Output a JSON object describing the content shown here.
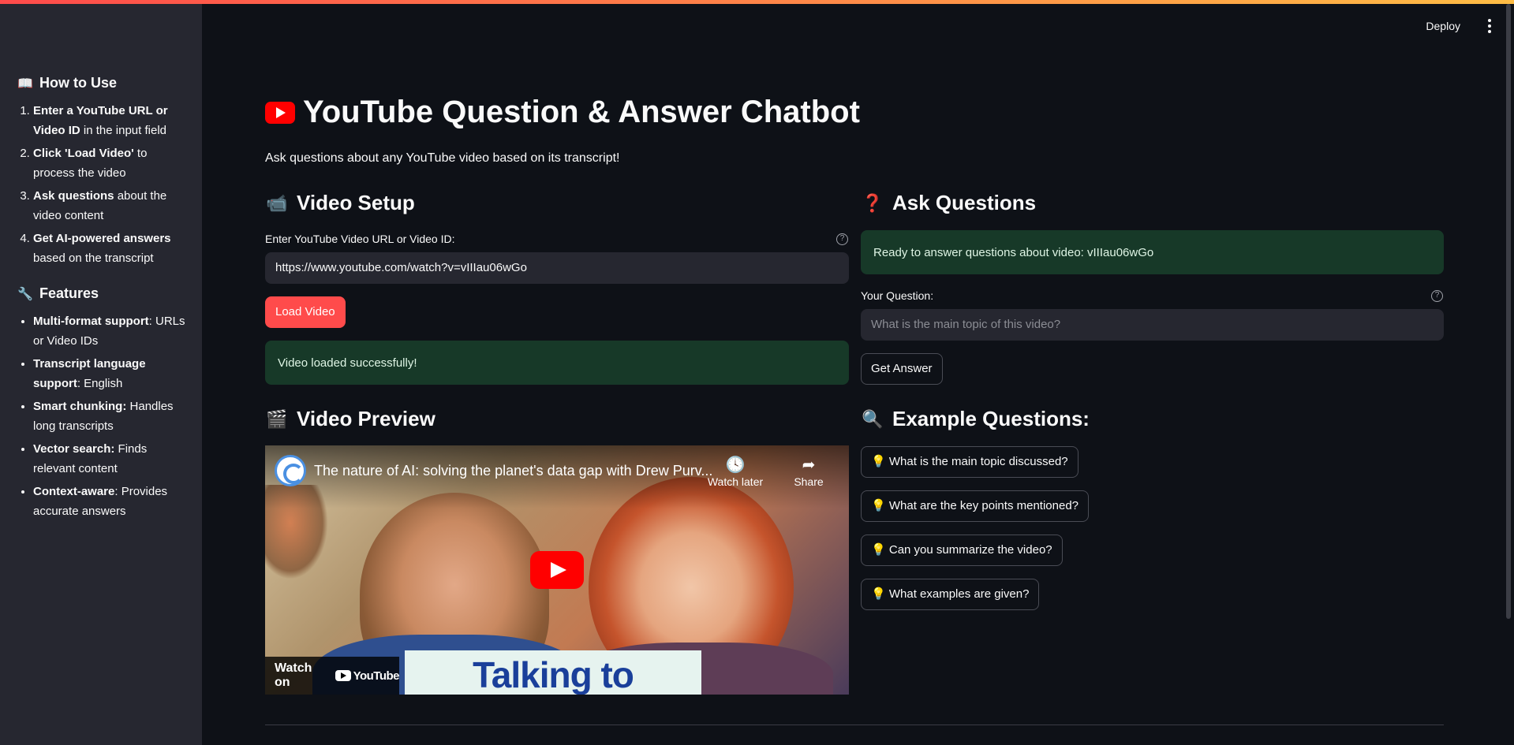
{
  "header": {
    "deploy_label": "Deploy"
  },
  "sidebar": {
    "how_to_use": {
      "title": "How to Use",
      "icon": "book-icon",
      "items": [
        {
          "bold": "Enter a YouTube URL or Video ID",
          "rest": " in the input field"
        },
        {
          "bold": "Click 'Load Video'",
          "rest": " to process the video"
        },
        {
          "bold": "Ask questions",
          "rest": " about the video content"
        },
        {
          "bold": "Get AI-powered answers",
          "rest": " based on the transcript"
        }
      ]
    },
    "features": {
      "title": "Features",
      "icon": "wrench-icon",
      "items": [
        {
          "bold": "Multi-format support",
          "rest": ": URLs or Video IDs"
        },
        {
          "bold": "Transcript language support",
          "rest": ": English"
        },
        {
          "bold": "Smart chunking:",
          "rest": " Handles long transcripts"
        },
        {
          "bold": "Vector search:",
          "rest": " Finds relevant content"
        },
        {
          "bold": "Context-aware",
          "rest": ": Provides accurate answers"
        }
      ]
    }
  },
  "main": {
    "title": "YouTube Question & Answer Chatbot",
    "subtitle": "Ask questions about any YouTube video based on its transcript!",
    "video_setup": {
      "heading": "Video Setup",
      "icon": "video-camera-icon",
      "input_label": "Enter YouTube Video URL or Video ID:",
      "input_value": "https://www.youtube.com/watch?v=vIIIau06wGo",
      "load_button": "Load Video",
      "success_message": "Video loaded successfully!"
    },
    "video_preview": {
      "heading": "Video Preview",
      "icon": "clapperboard-icon",
      "video_title": "The nature of AI: solving the planet's data gap with Drew Purv...",
      "watch_later": "Watch later",
      "share": "Share",
      "watch_on": "Watch on",
      "youtube_wordmark": "YouTube",
      "thumbnail_card_text": "Talking to animals?"
    },
    "ask_questions": {
      "heading": "Ask Questions",
      "icon": "question-mark-icon",
      "ready_message": "Ready to answer questions about video: vIIIau06wGo",
      "question_label": "Your Question:",
      "question_placeholder": "What is the main topic of this video?",
      "get_answer_button": "Get Answer"
    },
    "example_questions": {
      "heading": "Example Questions:",
      "icon": "magnifier-icon",
      "items": [
        "What is the main topic discussed?",
        "What are the key points mentioned?",
        "Can you summarize the video?",
        "What examples are given?"
      ]
    }
  },
  "colors": {
    "background": "#0e1117",
    "sidebar": "#262730",
    "accent": "#ff4b4b",
    "success_bg": "#173928"
  }
}
